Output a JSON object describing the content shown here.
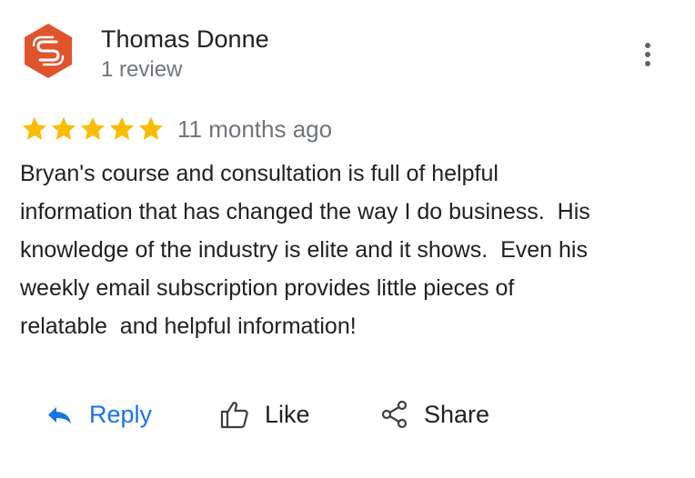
{
  "reviewer": {
    "name": "Thomas Donne",
    "review_count": "1 review",
    "avatar_icon": "brand-s-logo-icon",
    "avatar_color": "#e0542c"
  },
  "menu": {
    "icon": "more-vert-icon"
  },
  "review": {
    "rating": 5,
    "rating_max": 5,
    "star_color": "#fbbc04",
    "date": "11 months ago",
    "text": "Bryan's course and consultation is full of helpful\ninformation that has changed the way I do business.  His\nknowledge of the industry is elite and it shows.  Even his\nweekly email subscription provides little pieces of\nrelatable  and helpful information!"
  },
  "actions": {
    "reply": {
      "label": "Reply",
      "icon": "reply-arrow-icon",
      "color": "#1a73e8"
    },
    "like": {
      "label": "Like",
      "icon": "thumbs-up-icon"
    },
    "share": {
      "label": "Share",
      "icon": "share-icon"
    }
  }
}
